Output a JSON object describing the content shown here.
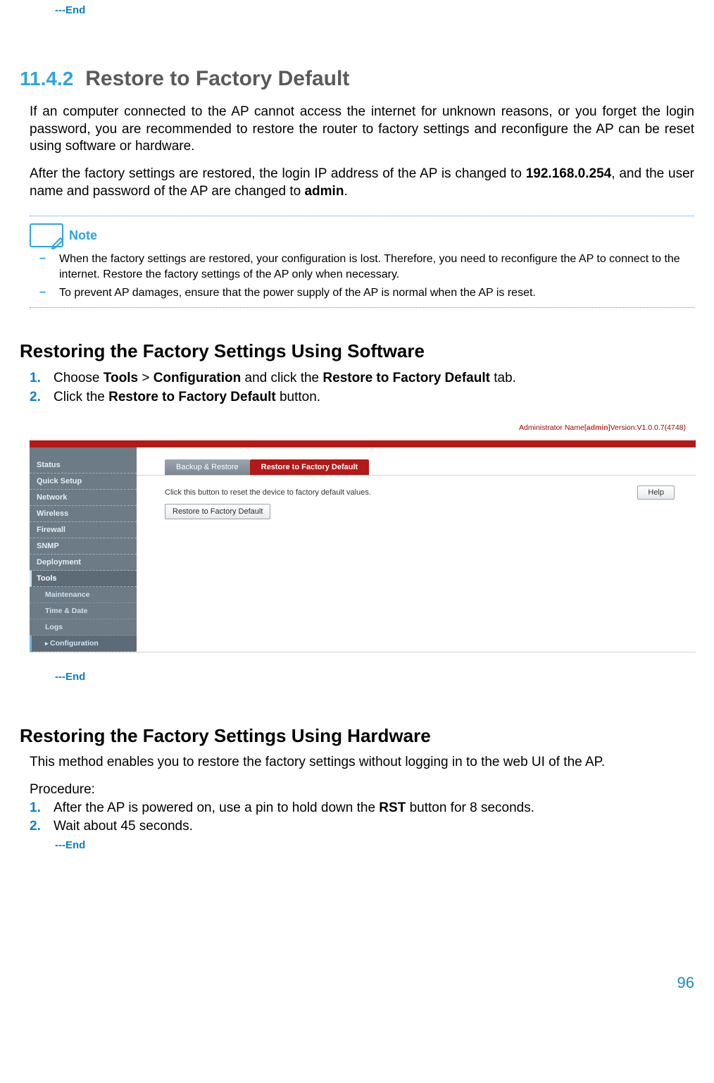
{
  "top_end": "---End",
  "section": {
    "number": "11.4.2",
    "title": "Restore to Factory Default"
  },
  "intro": {
    "p1_pre": "If an computer connected to the AP cannot access the internet for unknown reasons, or you forget the login password, you are recommended to restore the router to factory settings and reconfigure the AP can be reset using software or hardware.",
    "p2_a": "After the factory settings are restored, the login IP address of the AP is changed to ",
    "p2_ip": "192.168.0.254",
    "p2_b": ", and the user name and password of the AP are changed to ",
    "p2_admin": "admin",
    "p2_c": "."
  },
  "note": {
    "label": "Note",
    "items": [
      "When the factory settings are restored, your configuration is lost. Therefore, you need to reconfigure the AP to connect to the internet. Restore the factory settings of the AP only when necessary.",
      "To prevent AP damages, ensure that the power supply of the AP is normal when the AP is reset."
    ]
  },
  "sw": {
    "heading": "Restoring the Factory Settings Using Software",
    "step1_a": "Choose ",
    "step1_b": "Tools",
    "step1_c": " > ",
    "step1_d": "Configuration",
    "step1_e": " and click the ",
    "step1_f": "Restore to Factory Default",
    "step1_g": " tab.",
    "step2_a": "Click the ",
    "step2_b": "Restore to Factory Default",
    "step2_c": " button.",
    "end": "---End"
  },
  "hw": {
    "heading": "Restoring the Factory Settings Using Hardware",
    "p": "This method enables you to restore the factory settings without logging in to the web UI of the AP.",
    "procedure": "Procedure:",
    "step1_a": "After the AP is powered on, use a pin to hold down the ",
    "step1_b": "RST",
    "step1_c": " button for 8 seconds.",
    "step2": "Wait about 45 seconds.",
    "end": "---End"
  },
  "router": {
    "admin_label_a": "Administrator Name[",
    "admin_name": "admin",
    "admin_label_b": "]Version:V1.0.0.7(4748)",
    "sidebar": {
      "status": "Status",
      "quick": "Quick Setup",
      "network": "Network",
      "wireless": "Wireless",
      "firewall": "Firewall",
      "snmp": "SNMP",
      "deployment": "Deployment",
      "tools": "Tools",
      "maintenance": "Maintenance",
      "timedate": "Time & Date",
      "logs": "Logs",
      "configuration": "Configuration"
    },
    "tabs": {
      "backup": "Backup & Restore",
      "restore": "Restore to Factory Default"
    },
    "panel": {
      "desc": "Click this button to reset the device to factory default values.",
      "button": "Restore to Factory Default",
      "help": "Help"
    }
  },
  "page_number": "96"
}
